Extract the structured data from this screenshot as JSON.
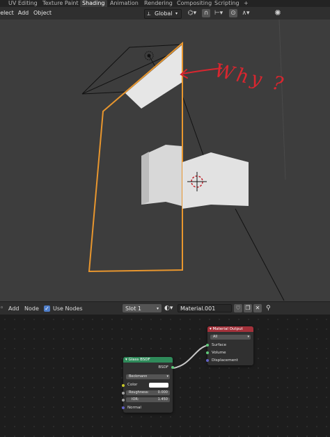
{
  "workspace_tabs": [
    {
      "label": "UV Editing"
    },
    {
      "label": "Texture Paint"
    },
    {
      "label": "Shading",
      "active": true
    },
    {
      "label": "Animation"
    },
    {
      "label": "Rendering"
    },
    {
      "label": "Compositing"
    },
    {
      "label": "Scripting"
    },
    {
      "label": "+"
    }
  ],
  "viewport_header": {
    "select_menu": "elect",
    "add_menu": "Add",
    "object_menu": "Object",
    "transform_orientation": "Global"
  },
  "viewport": {
    "annotation_text": "Why ?",
    "annotation_color": "#d9262f",
    "selection_color": "#e8962e"
  },
  "node_editor_header": {
    "add_menu": "Add",
    "node_menu": "Node",
    "use_nodes_label": "Use Nodes",
    "use_nodes_checked": true,
    "slot": "Slot 1",
    "material_name": "Material.001"
  },
  "nodes": {
    "material_output": {
      "title": "Material Output",
      "target": "All",
      "inputs": [
        "Surface",
        "Volume",
        "Displacement"
      ],
      "header_color": "#a3313a"
    },
    "glass_bsdf": {
      "title": "Glass BSDF",
      "output": "BSDF",
      "distribution": "Beckmann",
      "color_label": "Color",
      "roughness_label": "Roughness:",
      "roughness_value": "0.000",
      "ior_label": "IOR:",
      "ior_value": "1.450",
      "normal_label": "Normal",
      "header_color": "#2f8a5a"
    }
  }
}
